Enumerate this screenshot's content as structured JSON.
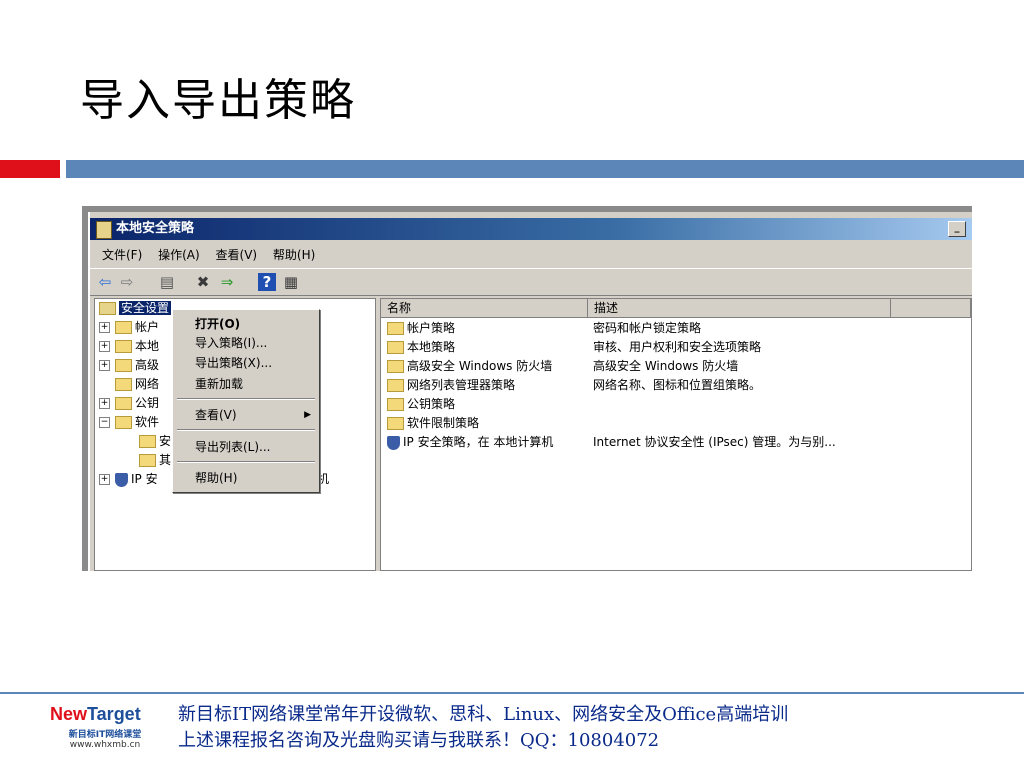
{
  "slide": {
    "title": "导入导出策略"
  },
  "window": {
    "title": "本地安全策略",
    "minimize": "_",
    "menu": [
      "文件(F)",
      "操作(A)",
      "查看(V)",
      "帮助(H)"
    ],
    "toolbar": [
      {
        "icon": "back-arrow-icon",
        "glyph": "⇦"
      },
      {
        "icon": "forward-arrow-icon",
        "glyph": "⇨"
      },
      {
        "icon": "show-hide-tree-icon",
        "glyph": "▤"
      },
      {
        "icon": "delete-icon",
        "glyph": "✖"
      },
      {
        "icon": "export-list-icon",
        "glyph": "⇒"
      },
      {
        "icon": "help-icon",
        "glyph": "?"
      },
      {
        "icon": "properties-icon",
        "glyph": "▦"
      }
    ],
    "tree": [
      {
        "label": "安全设置",
        "selected": true,
        "expand": "",
        "icon": "folder"
      },
      {
        "label": "帐户",
        "expand": "+",
        "icon": "folder"
      },
      {
        "label": "本地",
        "expand": "+",
        "icon": "folder"
      },
      {
        "label": "高级",
        "expand": "+",
        "icon": "folder"
      },
      {
        "label": "网络",
        "expand": "",
        "icon": "folder"
      },
      {
        "label": "公钥",
        "expand": "+",
        "icon": "folder"
      },
      {
        "label": "软件",
        "expand": "−",
        "icon": "folder"
      },
      {
        "label": "安",
        "expand": "",
        "icon": "folder",
        "indent": true
      },
      {
        "label": "其",
        "expand": "",
        "icon": "folder",
        "indent": true
      },
      {
        "label": "IP 安",
        "expand": "+",
        "icon": "shield",
        "suffix": "机"
      }
    ],
    "columns": [
      "名称",
      "描述"
    ],
    "list": [
      {
        "name": "帐户策略",
        "desc": "密码和帐户锁定策略",
        "icon": "folder"
      },
      {
        "name": "本地策略",
        "desc": "审核、用户权利和安全选项策略",
        "icon": "folder"
      },
      {
        "name": "高级安全 Windows 防火墙",
        "desc": "高级安全 Windows 防火墙",
        "icon": "folder"
      },
      {
        "name": "网络列表管理器策略",
        "desc": "网络名称、图标和位置组策略。",
        "icon": "folder"
      },
      {
        "name": "公钥策略",
        "desc": "",
        "icon": "folder"
      },
      {
        "name": "软件限制策略",
        "desc": "",
        "icon": "folder"
      },
      {
        "name": "IP 安全策略，在 本地计算机",
        "desc": "Internet 协议安全性 (IPsec) 管理。为与别...",
        "icon": "shield"
      }
    ],
    "context_menu": {
      "items": [
        "打开(O)",
        "导入策略(I)...",
        "导出策略(X)...",
        "重新加载",
        "查看(V)",
        "导出列表(L)...",
        "帮助(H)"
      ]
    }
  },
  "footer": {
    "logo_new": "New",
    "logo_target": "Target",
    "logo_sub": "新目标IT网络课堂",
    "logo_url": "www.whxmb.cn",
    "line1": "新目标IT网络课堂常年开设微软、思科、Linux、网络安全及Office高端培训",
    "line2": "上述课程报名咨询及光盘购买请与我联系！QQ：10804072"
  },
  "colors": {
    "accent_red": "#e0101a",
    "accent_blue": "#5d86b8",
    "titlebar": "#0a246a"
  }
}
